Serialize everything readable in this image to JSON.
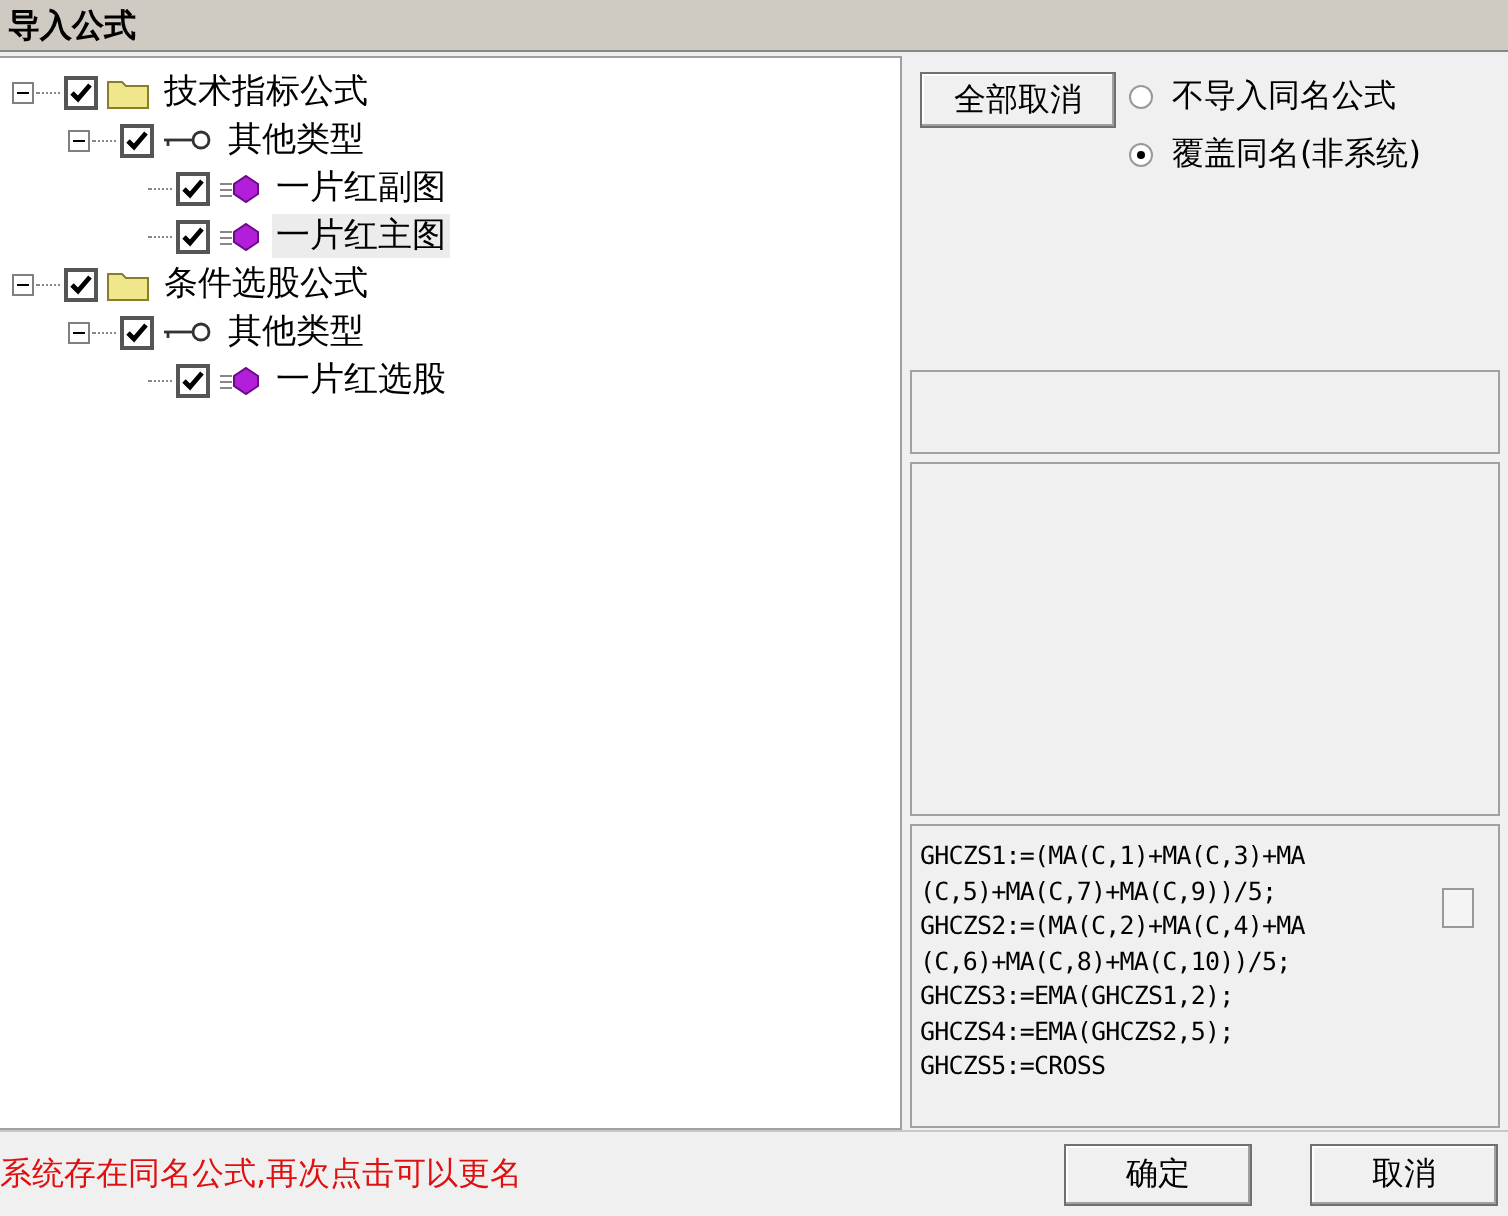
{
  "window": {
    "title": "导入公式"
  },
  "tree": [
    {
      "kind": "folder",
      "label": "技术指标公式",
      "checked": true,
      "expanded": true,
      "selected": false,
      "children": [
        {
          "kind": "group",
          "label": "其他类型",
          "checked": true,
          "expanded": true,
          "selected": false,
          "children": [
            {
              "kind": "formula",
              "label": "一片红副图",
              "checked": true,
              "selected": false
            },
            {
              "kind": "formula",
              "label": "一片红主图",
              "checked": true,
              "selected": true
            }
          ]
        }
      ]
    },
    {
      "kind": "folder",
      "label": "条件选股公式",
      "checked": true,
      "expanded": true,
      "selected": false,
      "children": [
        {
          "kind": "group",
          "label": "其他类型",
          "checked": true,
          "expanded": true,
          "selected": false,
          "children": [
            {
              "kind": "formula",
              "label": "一片红选股",
              "checked": true,
              "selected": false
            }
          ]
        }
      ]
    }
  ],
  "deselect_all_button": "全部取消",
  "options": [
    {
      "label": "不导入同名公式",
      "selected": false
    },
    {
      "label": "覆盖同名(非系统)",
      "selected": true
    }
  ],
  "formula_text": [
    "GHCZS1:=(MA(C,1)+MA(C,3)+MA",
    "(C,5)+MA(C,7)+MA(C,9))/5;",
    "GHCZS2:=(MA(C,2)+MA(C,4)+MA",
    "(C,6)+MA(C,8)+MA(C,10))/5;",
    "GHCZS3:=EMA(GHCZS1,2);",
    "GHCZS4:=EMA(GHCZS2,5);",
    "GHCZS5:=CROSS"
  ],
  "status": "系统存在同名公式,再次点击可以更名",
  "buttons": [
    "确定",
    "取消"
  ]
}
